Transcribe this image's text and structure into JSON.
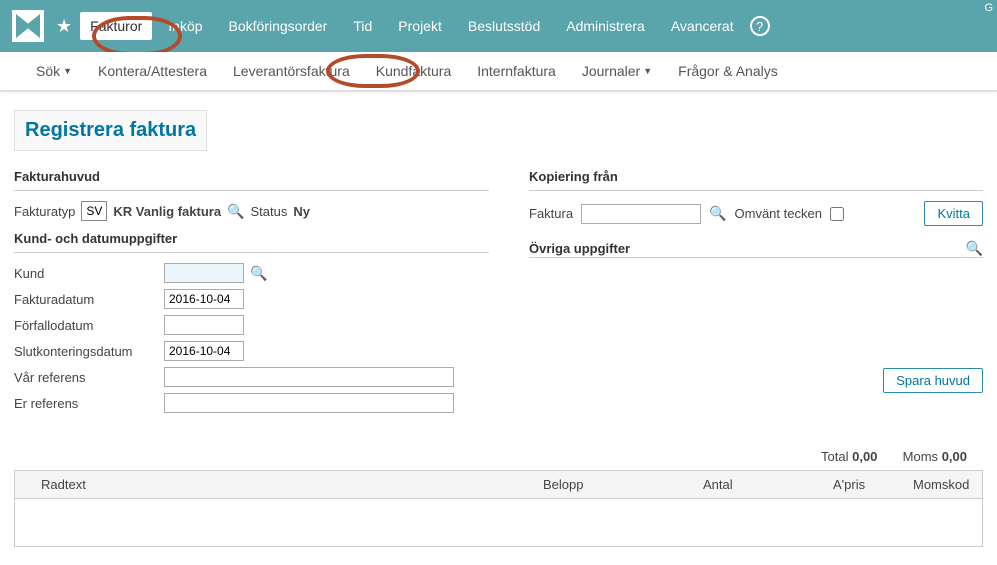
{
  "topbar": {
    "nav": {
      "fakturor": "Fakturor",
      "inkop": "Inköp",
      "bokforingsorder": "Bokföringsorder",
      "tid": "Tid",
      "projekt": "Projekt",
      "beslutsstod": "Beslutsstöd",
      "administrera": "Administrera",
      "avancerat": "Avancerat"
    },
    "help_symbol": "?",
    "top_right_letter": "G"
  },
  "subnav": {
    "sok": "Sök",
    "kontera_attestera": "Kontera/Attestera",
    "leverantorsfaktura": "Leverantörsfaktura",
    "kundfaktura": "Kundfaktura",
    "internfaktura": "Internfaktura",
    "journaler": "Journaler",
    "fragor_analys": "Frågor & Analys"
  },
  "page": {
    "title": "Registrera faktura"
  },
  "sections": {
    "fakturahuvud": "Fakturahuvud",
    "kopiering_fran": "Kopiering från",
    "kund_datum": "Kund- och datumuppgifter",
    "ovriga": "Övriga uppgifter"
  },
  "fakturatyp": {
    "label": "Fakturatyp",
    "code_value": "SV",
    "desc": "KR Vanlig faktura",
    "status_label": "Status",
    "status_value": "Ny"
  },
  "kopiering": {
    "faktura_label": "Faktura",
    "faktura_value": "",
    "omvant_label": "Omvänt tecken",
    "kvitta_btn": "Kvitta"
  },
  "fields": {
    "kund_label": "Kund",
    "kund_value": "",
    "fakturadatum_label": "Fakturadatum",
    "fakturadatum_value": "2016-10-04",
    "forfallodatum_label": "Förfallodatum",
    "forfallodatum_value": "",
    "slutkonteringsdatum_label": "Slutkonteringsdatum",
    "slutkonteringsdatum_value": "2016-10-04",
    "var_referens_label": "Vår referens",
    "var_referens_value": "",
    "er_referens_label": "Er referens",
    "er_referens_value": ""
  },
  "buttons": {
    "spara_huvud": "Spara huvud"
  },
  "totals": {
    "total_label": "Total",
    "total_value": "0,00",
    "moms_label": "Moms",
    "moms_value": "0,00"
  },
  "table": {
    "radtext": "Radtext",
    "belopp": "Belopp",
    "antal": "Antal",
    "apris": "A'pris",
    "momskod": "Momskod"
  }
}
